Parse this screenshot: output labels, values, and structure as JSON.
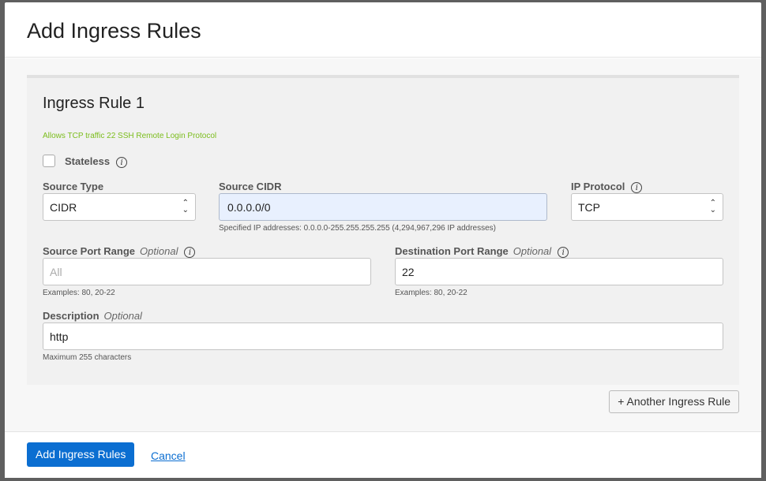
{
  "title": "Add Ingress Rules",
  "rule": {
    "heading": "Ingress Rule 1",
    "hint": "Allows TCP traffic 22 SSH Remote Login Protocol",
    "stateless_label": "Stateless",
    "source_type": {
      "label": "Source Type",
      "value": "CIDR"
    },
    "source_cidr": {
      "label": "Source CIDR",
      "value": "0.0.0.0/0",
      "help": "Specified IP addresses: 0.0.0.0-255.255.255.255 (4,294,967,296 IP addresses)"
    },
    "ip_protocol": {
      "label": "IP Protocol",
      "value": "TCP"
    },
    "source_port": {
      "label": "Source Port Range",
      "optional": "Optional",
      "placeholder": "All",
      "help": "Examples: 80, 20-22"
    },
    "dest_port": {
      "label": "Destination Port Range",
      "optional": "Optional",
      "value": "22",
      "help": "Examples: 80, 20-22"
    },
    "description": {
      "label": "Description",
      "optional": "Optional",
      "value": "http",
      "help": "Maximum 255 characters"
    }
  },
  "another_label": "+ Another Ingress Rule",
  "footer": {
    "submit": "Add Ingress Rules",
    "cancel": "Cancel"
  }
}
